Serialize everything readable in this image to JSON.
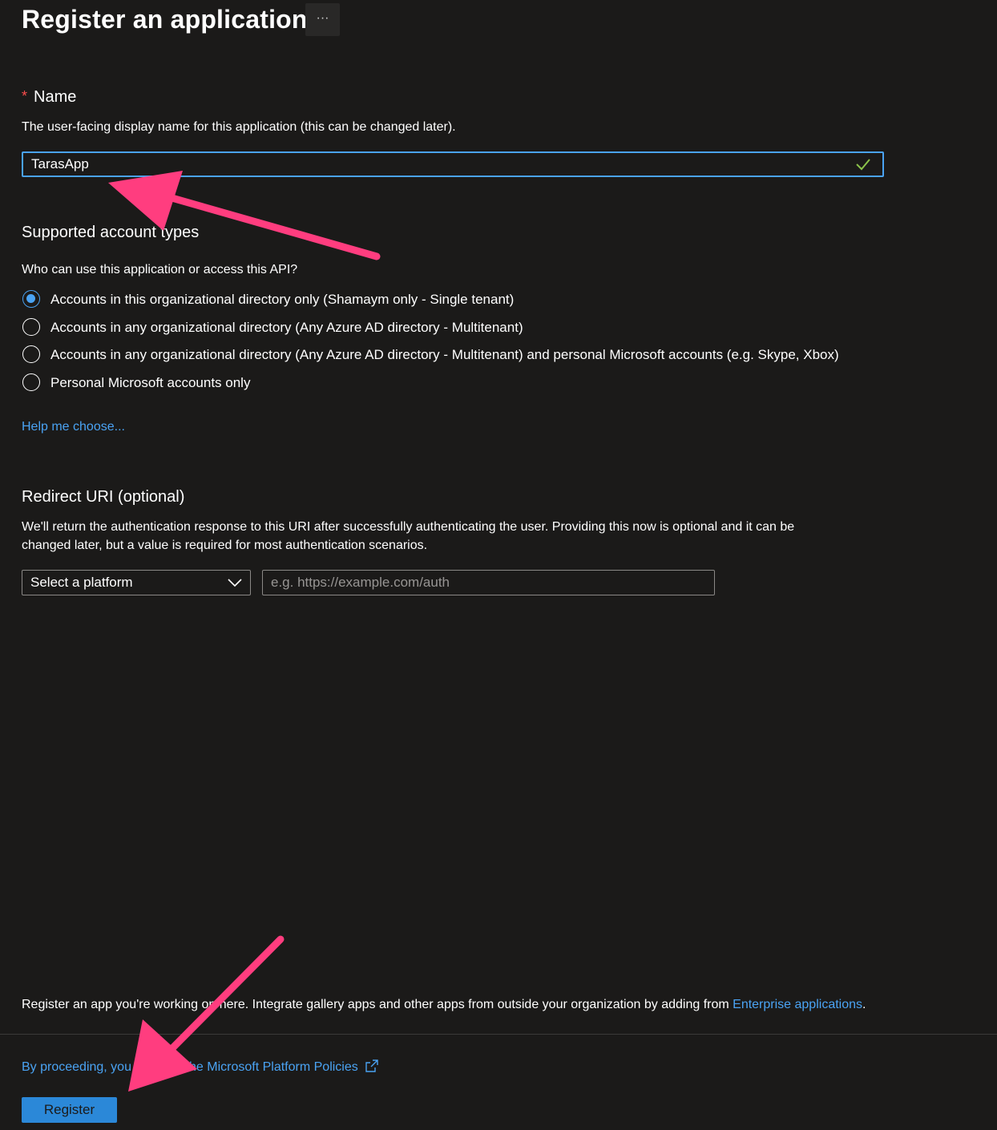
{
  "header": {
    "title": "Register an application",
    "more_label": "···"
  },
  "name_section": {
    "required_marker": "*",
    "label": "Name",
    "description": "The user-facing display name for this application (this can be changed later).",
    "value": "TarasApp",
    "valid": true
  },
  "account_types": {
    "heading": "Supported account types",
    "question": "Who can use this application or access this API?",
    "options": [
      {
        "label": "Accounts in this organizational directory only (Shamaym only - Single tenant)",
        "selected": true
      },
      {
        "label": "Accounts in any organizational directory (Any Azure AD directory - Multitenant)",
        "selected": false
      },
      {
        "label": "Accounts in any organizational directory (Any Azure AD directory - Multitenant) and personal Microsoft accounts (e.g. Skype, Xbox)",
        "selected": false
      },
      {
        "label": "Personal Microsoft accounts only",
        "selected": false
      }
    ],
    "help_link": "Help me choose..."
  },
  "redirect": {
    "heading": "Redirect URI (optional)",
    "description_line1": "We'll return the authentication response to this URI after successfully authenticating the user. Providing this now is optional and it can be",
    "description_line2": "changed later, but a value is required for most authentication scenarios.",
    "platform_select": "Select a platform",
    "uri_placeholder": "e.g. https://example.com/auth",
    "uri_value": ""
  },
  "footer": {
    "info_text": "Register an app you're working on here. Integrate gallery apps and other apps from outside your organization by adding from ",
    "info_link": "Enterprise applications",
    "info_end": ".",
    "policy_link": "By proceeding, you agree to the Microsoft Platform Policies",
    "register_label": "Register"
  },
  "colors": {
    "background": "#1b1a19",
    "accent": "#4aa3f3",
    "annotation_arrow": "#ff3d7f",
    "valid_check": "#8bc34a"
  },
  "icons": {
    "check": "checkmark-icon",
    "chevron": "chevron-down-icon",
    "external": "external-link-icon"
  }
}
